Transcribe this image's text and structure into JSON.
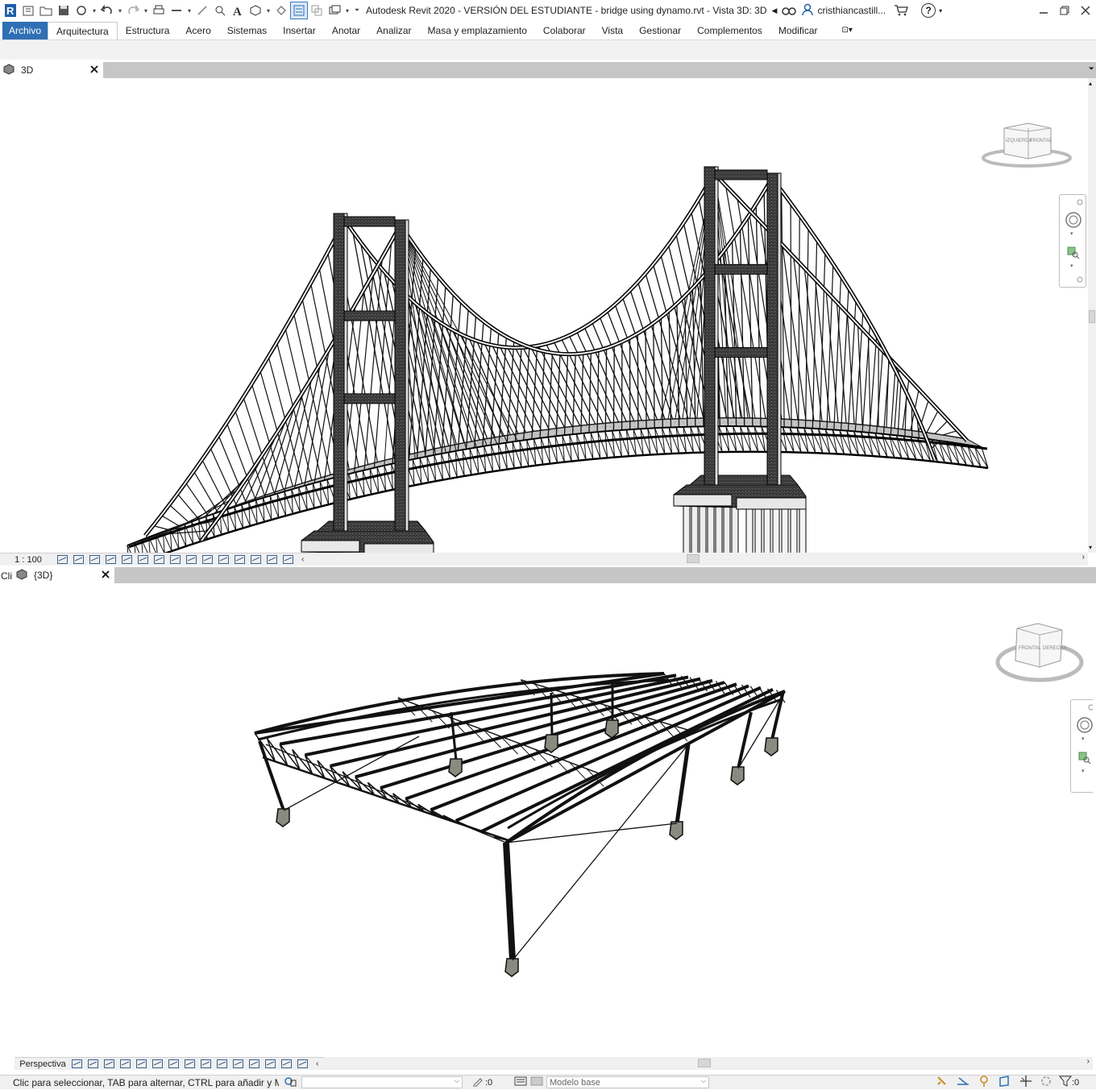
{
  "titlebar": {
    "app_title": "Autodesk Revit 2020 - VERSIÓN DEL ESTUDIANTE - bridge using dynamo.rvt - Vista 3D: 3D",
    "user_name": "cristhiancastill...",
    "help_label": "?"
  },
  "ribbon": {
    "tabs": [
      {
        "label": "Archivo"
      },
      {
        "label": "Arquitectura"
      },
      {
        "label": "Estructura"
      },
      {
        "label": "Acero"
      },
      {
        "label": "Sistemas"
      },
      {
        "label": "Insertar"
      },
      {
        "label": "Anotar"
      },
      {
        "label": "Analizar"
      },
      {
        "label": "Masa y emplazamiento"
      },
      {
        "label": "Colaborar"
      },
      {
        "label": "Vista"
      },
      {
        "label": "Gestionar"
      },
      {
        "label": "Complementos"
      },
      {
        "label": "Modificar"
      }
    ],
    "active_tab": "Arquitectura"
  },
  "views": {
    "top": {
      "tab_label": "3D",
      "scale": "1 : 100",
      "viewcube_faces": [
        "IZQUIERDA",
        "FRONTAL"
      ]
    },
    "bottom": {
      "tab_label": "{3D}",
      "left_clip": "Cli",
      "scale": "Perspectiva",
      "viewcube_faces": [
        "FRONTAL",
        "DERECHA"
      ]
    }
  },
  "statusbar": {
    "message": "Clic para seleccionar, TAB para alternar, CTRL para añadir y MAY",
    "selection_count": ":0",
    "model_select": "Modelo base",
    "filter_count": ":0"
  },
  "colors": {
    "file_tab": "#2f6fb4",
    "view_tabbar": "#c6c6c6",
    "ribbon_panel": "#f2f2f2"
  }
}
